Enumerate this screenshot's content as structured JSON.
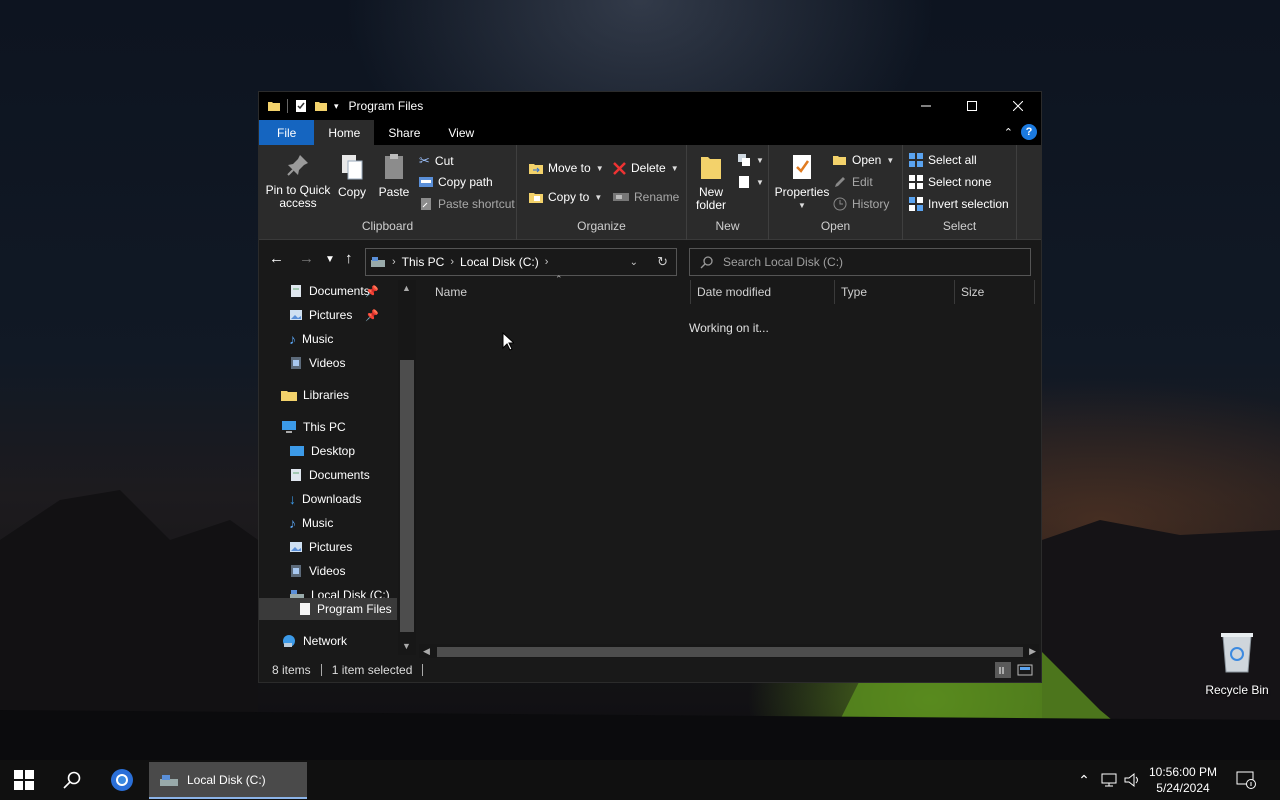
{
  "window": {
    "title": "Program Files",
    "tabs": {
      "file": "File",
      "home": "Home",
      "share": "Share",
      "view": "View"
    },
    "help_label": "?"
  },
  "ribbon": {
    "clipboard": {
      "label": "Clipboard",
      "pin_line1": "Pin to Quick",
      "pin_line2": "access",
      "copy": "Copy",
      "paste": "Paste",
      "cut": "Cut",
      "copy_path": "Copy path",
      "paste_shortcut": "Paste shortcut"
    },
    "organize": {
      "label": "Organize",
      "move_to": "Move to",
      "copy_to": "Copy to",
      "delete": "Delete",
      "rename": "Rename"
    },
    "new": {
      "label": "New",
      "new_folder_line1": "New",
      "new_folder_line2": "folder"
    },
    "open": {
      "label": "Open",
      "properties": "Properties",
      "open": "Open",
      "edit": "Edit",
      "history": "History"
    },
    "select": {
      "label": "Select",
      "select_all": "Select all",
      "select_none": "Select none",
      "invert_selection": "Invert selection"
    }
  },
  "address": {
    "crumbs": [
      "This PC",
      "Local Disk (C:)"
    ],
    "search_placeholder": "Search Local Disk (C:)"
  },
  "navpane": {
    "items": [
      "Documents",
      "Pictures",
      "Music",
      "Videos",
      "Libraries",
      "This PC",
      "Desktop",
      "Documents",
      "Downloads",
      "Music",
      "Pictures",
      "Videos",
      "Local Disk (C:)",
      "Program Files",
      "Network"
    ]
  },
  "content": {
    "columns": [
      "Name",
      "Date modified",
      "Type",
      "Size"
    ],
    "status_message": "Working on it..."
  },
  "statusbar": {
    "items_count": "8 items",
    "selection": "1 item selected"
  },
  "desktop": {
    "recycle_bin": "Recycle Bin"
  },
  "taskbar": {
    "task_label": "Local Disk (C:)",
    "time": "10:56:00 PM",
    "date": "5/24/2024"
  },
  "colors": {
    "file_tab": "#1565c0",
    "ribbon_bg": "#2b2b2b",
    "window_bg": "#191919",
    "titlebar_bg": "#000000"
  }
}
